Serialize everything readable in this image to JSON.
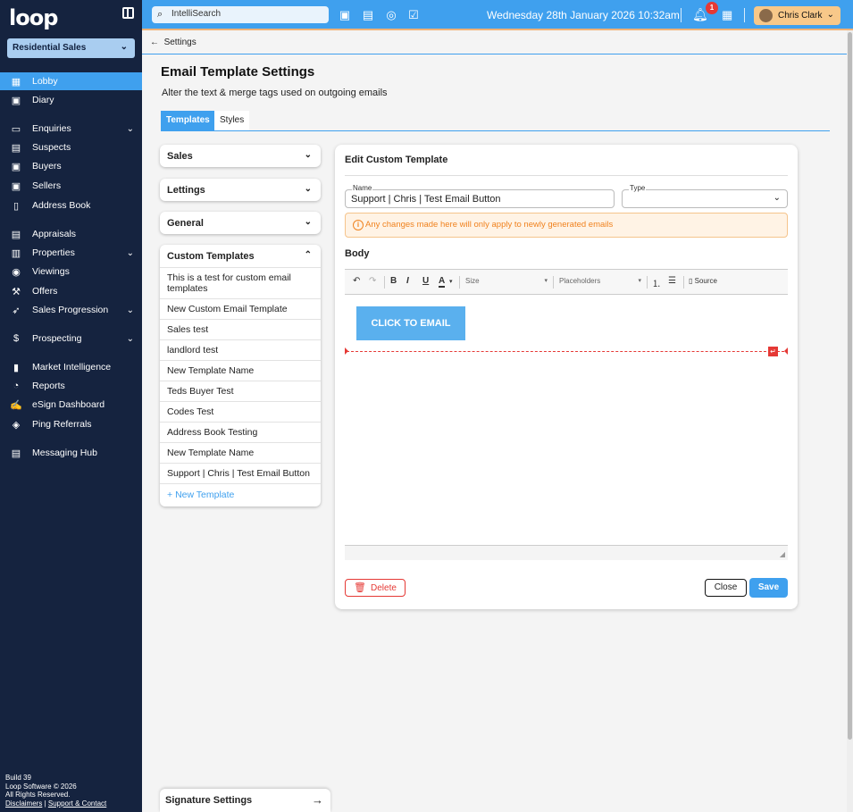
{
  "app": {
    "logo": "loop"
  },
  "sidebar": {
    "branch": "Residential Sales",
    "items": [
      {
        "label": "Lobby",
        "icon": "dashboard-icon",
        "active": true
      },
      {
        "label": "Diary",
        "icon": "calendar-icon"
      },
      {
        "label": "Enquiries",
        "icon": "inbox-icon",
        "expandable": true
      },
      {
        "label": "Suspects",
        "icon": "contact-card-icon"
      },
      {
        "label": "Buyers",
        "icon": "person-card-icon"
      },
      {
        "label": "Sellers",
        "icon": "person-card-icon"
      },
      {
        "label": "Address Book",
        "icon": "book-icon"
      },
      {
        "label": "Appraisals",
        "icon": "clipboard-icon"
      },
      {
        "label": "Properties",
        "icon": "building-icon",
        "expandable": true
      },
      {
        "label": "Viewings",
        "icon": "eye-icon"
      },
      {
        "label": "Offers",
        "icon": "gavel-icon"
      },
      {
        "label": "Sales Progression",
        "icon": "rocket-icon",
        "expandable": true
      },
      {
        "label": "Prospecting",
        "icon": "dollar-icon",
        "expandable": true
      },
      {
        "label": "Market Intelligence",
        "icon": "chart-icon"
      },
      {
        "label": "Reports",
        "icon": "pie-chart-icon"
      },
      {
        "label": "eSign Dashboard",
        "icon": "signature-icon"
      },
      {
        "label": "Ping Referrals",
        "icon": "handshake-icon"
      },
      {
        "label": "Messaging Hub",
        "icon": "message-icon"
      }
    ],
    "build": "Build 39",
    "copyright": "Loop Software © 2026",
    "rights": "All Rights Reserved.",
    "disclaimers": "Disclaimers",
    "support": "Support & Contact"
  },
  "topbar": {
    "search_placeholder": "IntelliSearch",
    "datetime": "Wednesday 28th January 2026 10:32am",
    "notification_count": "1",
    "user_name": "Chris Clark"
  },
  "breadcrumb": "Settings",
  "page": {
    "title": "Email Template Settings",
    "subtitle": "Alter the text & merge tags used on outgoing emails",
    "tabs": [
      "Templates",
      "Styles"
    ]
  },
  "accordions": {
    "sales": "Sales",
    "lettings": "Lettings",
    "general": "General",
    "custom": "Custom Templates"
  },
  "custom_templates": [
    "This is a test for custom email templates",
    "New Custom Email Template",
    "Sales test",
    "landlord test",
    "New Template Name",
    "Teds Buyer Test",
    "Codes Test",
    "Address Book Testing",
    "New Template Name",
    "Support | Chris | Test Email Button"
  ],
  "new_template_label": "New Template",
  "signature_settings": "Signature Settings",
  "editor": {
    "title": "Edit Custom Template",
    "name_label": "Name",
    "name_value": "Support | Chris | Test Email Button",
    "type_label": "Type",
    "type_value": "",
    "warning": "Any changes made here will only apply to newly generated emails",
    "body_label": "Body",
    "toolbar": {
      "size_label": "Size",
      "placeholders_label": "Placeholders",
      "source_label": "Source"
    },
    "cta_text": "CLICK TO EMAIL",
    "delete_label": "Delete",
    "close_label": "Close",
    "save_label": "Save"
  },
  "colors": {
    "sidebar_bg": "#15233f",
    "accent": "#3fa0ee",
    "warning": "#f0821e",
    "danger": "#e53935"
  }
}
